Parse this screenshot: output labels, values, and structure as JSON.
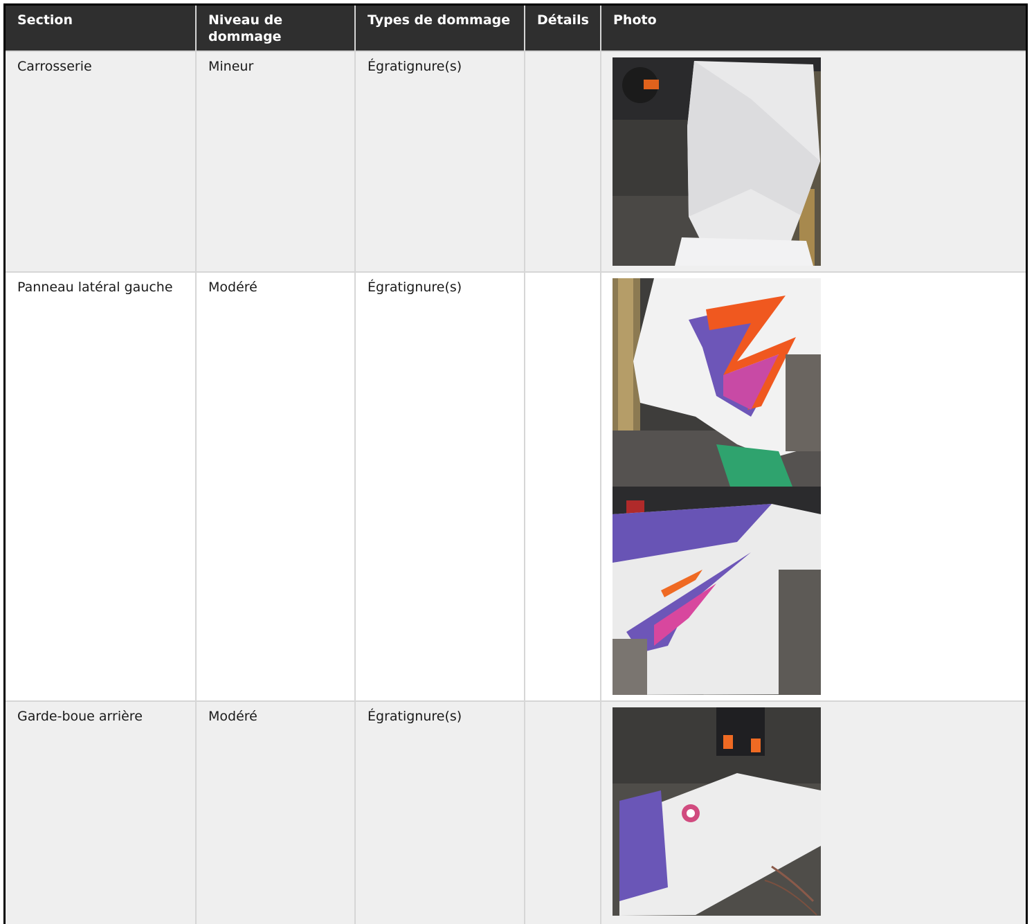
{
  "table": {
    "headers": [
      "Section",
      "Niveau de dommage",
      "Types de dommage",
      "Détails",
      "Photo"
    ],
    "rows": [
      {
        "section": "Carrosserie",
        "level": "Mineur",
        "type": "Égratignure(s)",
        "details": "",
        "photos": [
          "photo-front-fairing"
        ]
      },
      {
        "section": "Panneau latéral gauche",
        "level": "Modéré",
        "type": "Égratignure(s)",
        "details": "",
        "photos": [
          "photo-side-panel-front",
          "photo-side-panel-rear"
        ]
      },
      {
        "section": "Garde-boue arrière",
        "level": "Modéré",
        "type": "Égratignure(s)",
        "details": "",
        "photos": [
          "photo-rear-fender"
        ]
      }
    ]
  },
  "colors": {
    "header_bg": "#2f2f2f",
    "header_text": "#ffffff",
    "row_alt_bg": "#efefef",
    "grid": "#d6d6d6"
  }
}
